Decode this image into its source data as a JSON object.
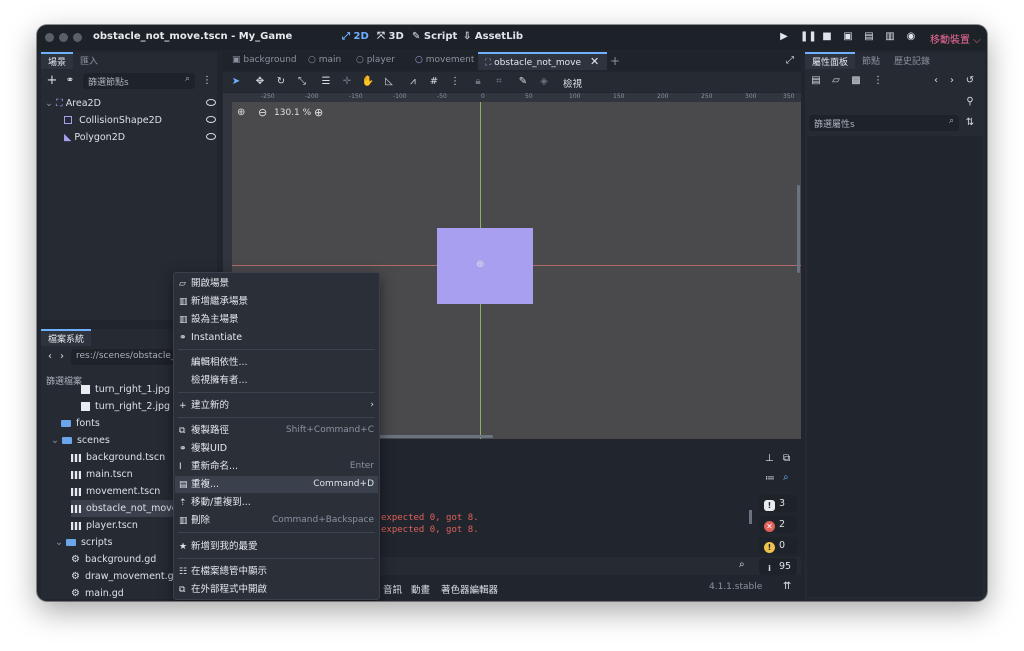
{
  "window": {
    "title": "obstacle_not_move.tscn - My_Game",
    "modes": [
      "2D",
      "3D",
      "Script",
      "AssetLib"
    ],
    "device_label": "移動裝置 ⌵"
  },
  "scene_dock": {
    "tabs": [
      "場景",
      "匯入"
    ],
    "filter_placeholder": "篩選節點s",
    "nodes": [
      "Area2D",
      "CollisionShape2D",
      "Polygon2D"
    ]
  },
  "filesystem": {
    "tab": "檔案系統",
    "path": "res://scenes/obstacle_n",
    "filter_placeholder": "篩選檔案",
    "items": [
      "turn_right_1.jpg",
      "turn_right_2.jpg",
      "fonts",
      "scenes",
      "background.tscn",
      "main.tscn",
      "movement.tscn",
      "obstacle_not_move.t",
      "player.tscn",
      "scripts",
      "background.gd",
      "draw_movement.gd",
      "main.gd"
    ]
  },
  "scene_tabs": [
    "background",
    "main",
    "player",
    "movement",
    "obstacle_not_move"
  ],
  "editor": {
    "view_label": "檢視",
    "zoom": "130.1 %",
    "ruler_ticks": [
      "-250",
      "-200",
      "-150",
      "-100",
      "-50",
      "0",
      "50",
      "100",
      "150",
      "200",
      "250",
      "300",
      "350"
    ],
    "errors": [
      "expected 0, got 8.",
      "expected 0, got 8."
    ],
    "bottom_tabs": [
      "音訊",
      "動畫",
      "著色器編輯器"
    ],
    "version": "4.1.1.stable"
  },
  "counters": [
    "3",
    "2",
    "0",
    "95"
  ],
  "inspector": {
    "tabs": [
      "屬性面板",
      "節點",
      "歷史記錄"
    ],
    "filter_placeholder": "篩選屬性s"
  },
  "context_menu": [
    {
      "label": "開啟場景",
      "shortcut": ""
    },
    {
      "label": "新增繼承場景",
      "shortcut": ""
    },
    {
      "label": "設為主場景",
      "shortcut": ""
    },
    {
      "label": "Instantiate",
      "shortcut": ""
    },
    {
      "label": "編輯相依性...",
      "shortcut": ""
    },
    {
      "label": "檢視擁有者...",
      "shortcut": ""
    },
    {
      "label": "建立新的",
      "shortcut": "›"
    },
    {
      "label": "複製路徑",
      "shortcut": "Shift+Command+C"
    },
    {
      "label": "複製UID",
      "shortcut": ""
    },
    {
      "label": "重新命名...",
      "shortcut": "Enter"
    },
    {
      "label": "重複...",
      "shortcut": "Command+D"
    },
    {
      "label": "移動/重複到...",
      "shortcut": ""
    },
    {
      "label": "刪除",
      "shortcut": "Command+Backspace"
    },
    {
      "label": "新增到我的最愛",
      "shortcut": ""
    },
    {
      "label": "在檔案總管中顯示",
      "shortcut": ""
    },
    {
      "label": "在外部程式中開啟",
      "shortcut": ""
    }
  ],
  "colors": {
    "accent": "#6fb0ff",
    "shape": "#a89ff0",
    "error": "#e0605a",
    "warning": "#f0c14b"
  }
}
